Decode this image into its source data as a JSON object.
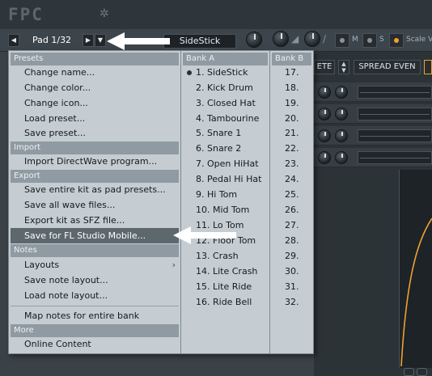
{
  "header": {
    "logo": "FPC",
    "settings_icon": "gear-icon"
  },
  "toolbar": {
    "pad_label": "Pad 1/32",
    "sample_name": "SideStick",
    "m_label": "M",
    "s_label": "S",
    "scale_label": "Scale V",
    "prev_icon": "arrow-left-icon",
    "next_icon": "arrow-right-icon",
    "menu_icon": "chevron-down-icon"
  },
  "right_panel": {
    "partial_button": "ETE",
    "spread_button": "SPREAD EVEN"
  },
  "menu": {
    "sections": {
      "presets": "Presets",
      "import": "Import",
      "export": "Export",
      "notes": "Notes",
      "more": "More"
    },
    "items": {
      "change_name": "Change name...",
      "change_color": "Change color...",
      "change_icon": "Change icon...",
      "load_preset": "Load preset...",
      "save_preset": "Save preset...",
      "import_directwave": "Import DirectWave program...",
      "save_kit_presets": "Save entire kit as pad presets...",
      "save_wave_files": "Save all wave files...",
      "export_sfz": "Export kit as SFZ file...",
      "save_fl_mobile": "Save for FL Studio Mobile...",
      "layouts": "Layouts",
      "save_note_layout": "Save note layout...",
      "load_note_layout": "Load note layout...",
      "map_notes": "Map notes for entire bank",
      "online_content": "Online Content"
    },
    "bank_a_header": "Bank A",
    "bank_b_header": "Bank B",
    "bank_a": [
      "1. SideStick",
      "2. Kick Drum",
      "3. Closed Hat",
      "4. Tambourine",
      "5. Snare 1",
      "6. Snare 2",
      "7. Open HiHat",
      "8. Pedal Hi Hat",
      "9. Hi Tom",
      "10. Mid Tom",
      "11. Lo Tom",
      "12. Floor Tom",
      "13. Crash",
      "14. Lite Crash",
      "15. Lite Ride",
      "16. Ride Bell"
    ],
    "bank_b": [
      "17.",
      "18.",
      "19.",
      "20.",
      "21.",
      "22.",
      "23.",
      "24.",
      "25.",
      "26.",
      "27.",
      "28.",
      "29.",
      "30.",
      "31.",
      "32."
    ],
    "selected_bank_a_index": 0
  },
  "colors": {
    "accent": "#f0a030",
    "menu_bg": "#c5cdd3",
    "menu_highlight": "#5d676e",
    "section_header": "#8f9aa2"
  }
}
